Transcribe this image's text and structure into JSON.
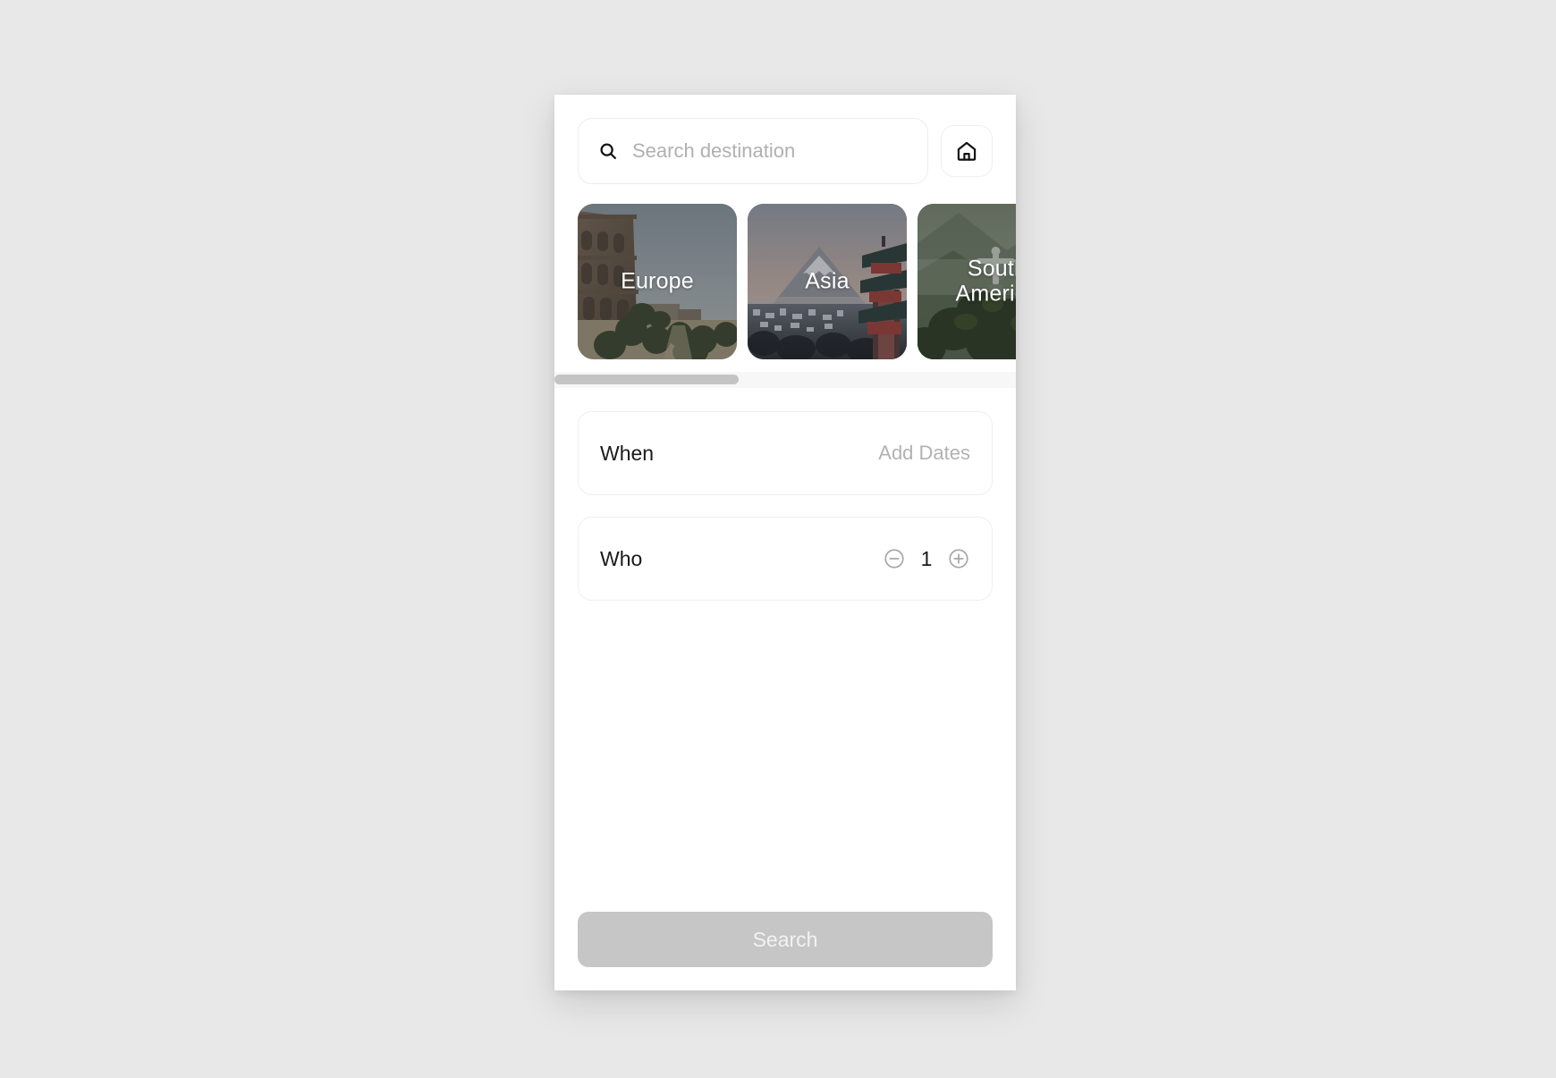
{
  "app": {
    "background_color": "#e8e8e8",
    "surface_color": "#ffffff"
  },
  "search": {
    "icon": "search-icon",
    "placeholder": "Search destination",
    "value": ""
  },
  "home_button": {
    "icon": "home-icon",
    "label": "Home"
  },
  "regions": {
    "scroll_thumb_pct": 40,
    "items": [
      {
        "label": "Europe",
        "art": "colosseum-rome"
      },
      {
        "label": "Asia",
        "art": "mount-fuji-pagoda"
      },
      {
        "label": "South\nAmerica",
        "art": "christ-the-redeemer"
      }
    ]
  },
  "options": [
    {
      "label": "When",
      "value": "Add Dates",
      "type": "text"
    },
    {
      "label": "Who",
      "value": "1",
      "type": "stepper",
      "decrement": "minus-circle-icon",
      "increment": "plus-circle-icon"
    }
  ],
  "footer": {
    "search_label": "Search",
    "search_enabled": false,
    "search_bg": "#c6c6c6",
    "search_fg": "#f2f2f2"
  }
}
